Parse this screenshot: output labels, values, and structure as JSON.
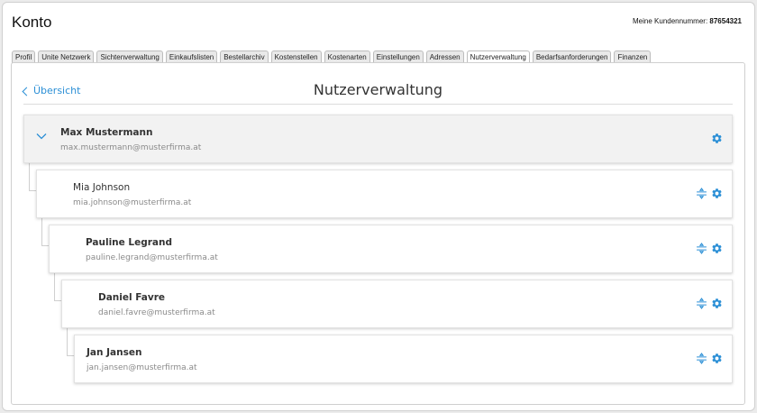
{
  "header": {
    "title": "Konto",
    "customer_label": "Meine Kundennummer:",
    "customer_number": "87654321"
  },
  "tabs": [
    {
      "label": "Profil"
    },
    {
      "label": "Unite Netzwerk"
    },
    {
      "label": "Sichtenverwaltung"
    },
    {
      "label": "Einkaufslisten"
    },
    {
      "label": "Bestellarchiv"
    },
    {
      "label": "Kostenstellen"
    },
    {
      "label": "Kostenarten"
    },
    {
      "label": "Einstellungen"
    },
    {
      "label": "Adressen"
    },
    {
      "label": "Nutzerverwaltung",
      "active": true
    },
    {
      "label": "Bedarfsanforderungen"
    },
    {
      "label": "Finanzen"
    }
  ],
  "main": {
    "back_label": "Übersicht",
    "section_title": "Nutzerverwaltung"
  },
  "users": [
    {
      "name": "Max Mustermann",
      "email": "max.mustermann@musterfirma.at"
    },
    {
      "name": "Mia Johnson",
      "email": "mia.johnson@musterfirma.at"
    },
    {
      "name": "Pauline Legrand",
      "email": "pauline.legrand@musterfirma.at"
    },
    {
      "name": "Daniel Favre",
      "email": "daniel.favre@musterfirma.at"
    },
    {
      "name": "Jan Jansen",
      "email": "jan.jansen@musterfirma.at"
    }
  ],
  "icons": {
    "back": "chevron-left-icon",
    "expand": "chevron-down-icon",
    "settings": "gear-icon",
    "move": "reorder-icon"
  },
  "colors": {
    "accent": "#2b8fd6",
    "card_top_bg": "#f2f2f2",
    "muted_text": "#8a8a8a"
  }
}
